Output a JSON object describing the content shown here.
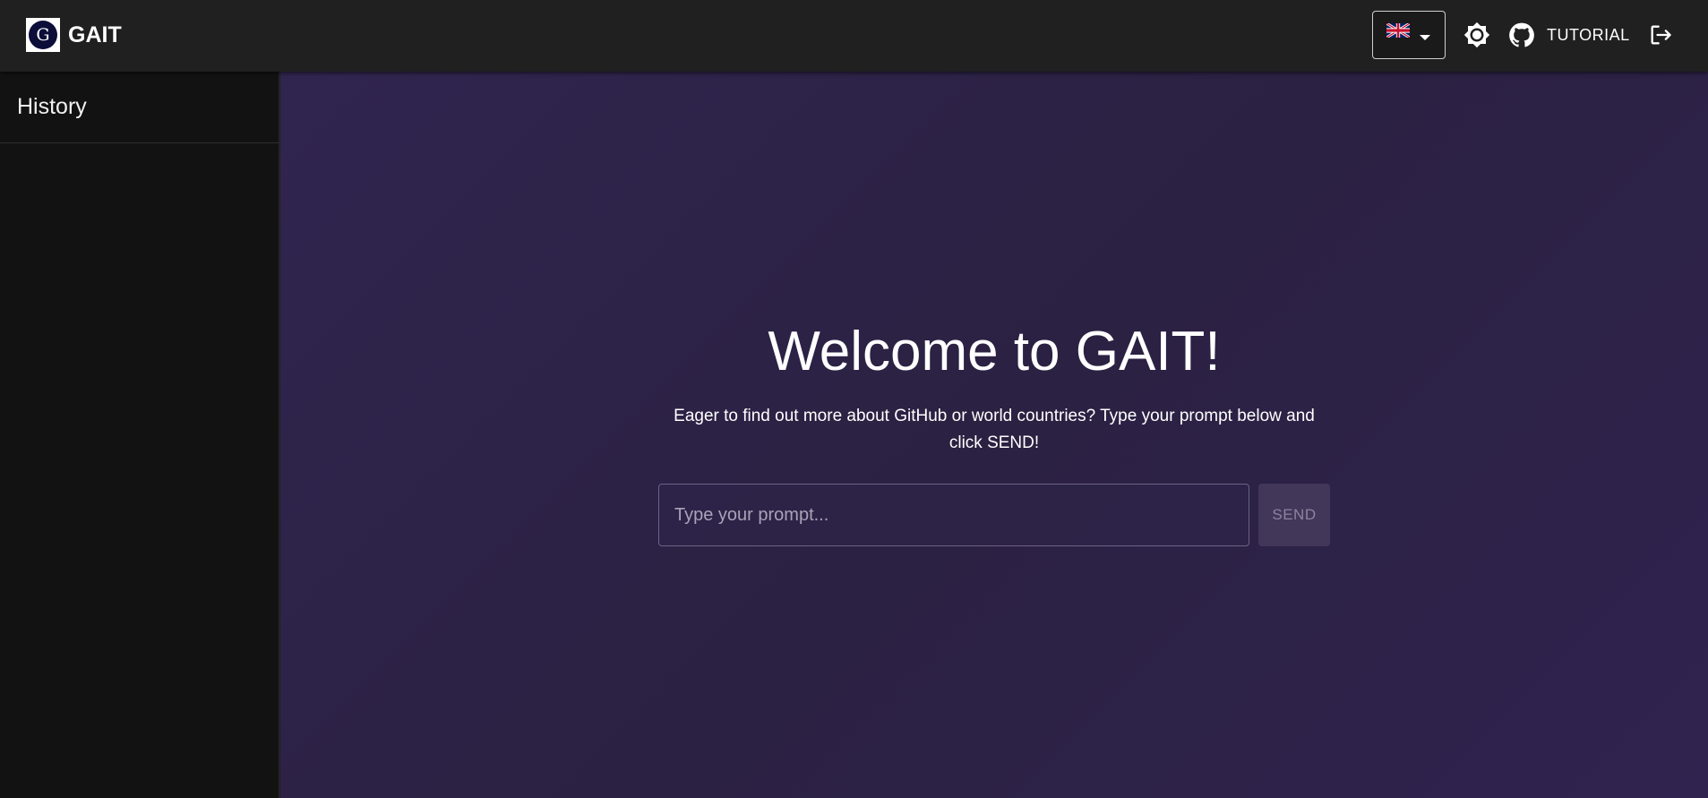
{
  "header": {
    "logo_letter": "G",
    "app_title": "GAIT",
    "language": {
      "selected": "en-GB",
      "icon": "uk-flag-icon"
    },
    "theme_toggle_icon": "sun-icon",
    "github_icon": "github-icon",
    "tutorial_label": "TUTORIAL",
    "logout_icon": "logout-icon"
  },
  "sidebar": {
    "title": "History",
    "items": []
  },
  "main": {
    "welcome_title": "Welcome to GAIT!",
    "subtitle": "Eager to find out more about GitHub or world countries? Type your prompt below and click SEND!",
    "prompt": {
      "value": "",
      "placeholder": "Type your prompt..."
    },
    "send_label": "SEND"
  },
  "colors": {
    "topbar_bg": "#202020",
    "sidebar_bg": "#121212",
    "main_bg": "#2e2349",
    "send_disabled_bg": "#423659",
    "logo_circle": "#0d0d3a"
  }
}
